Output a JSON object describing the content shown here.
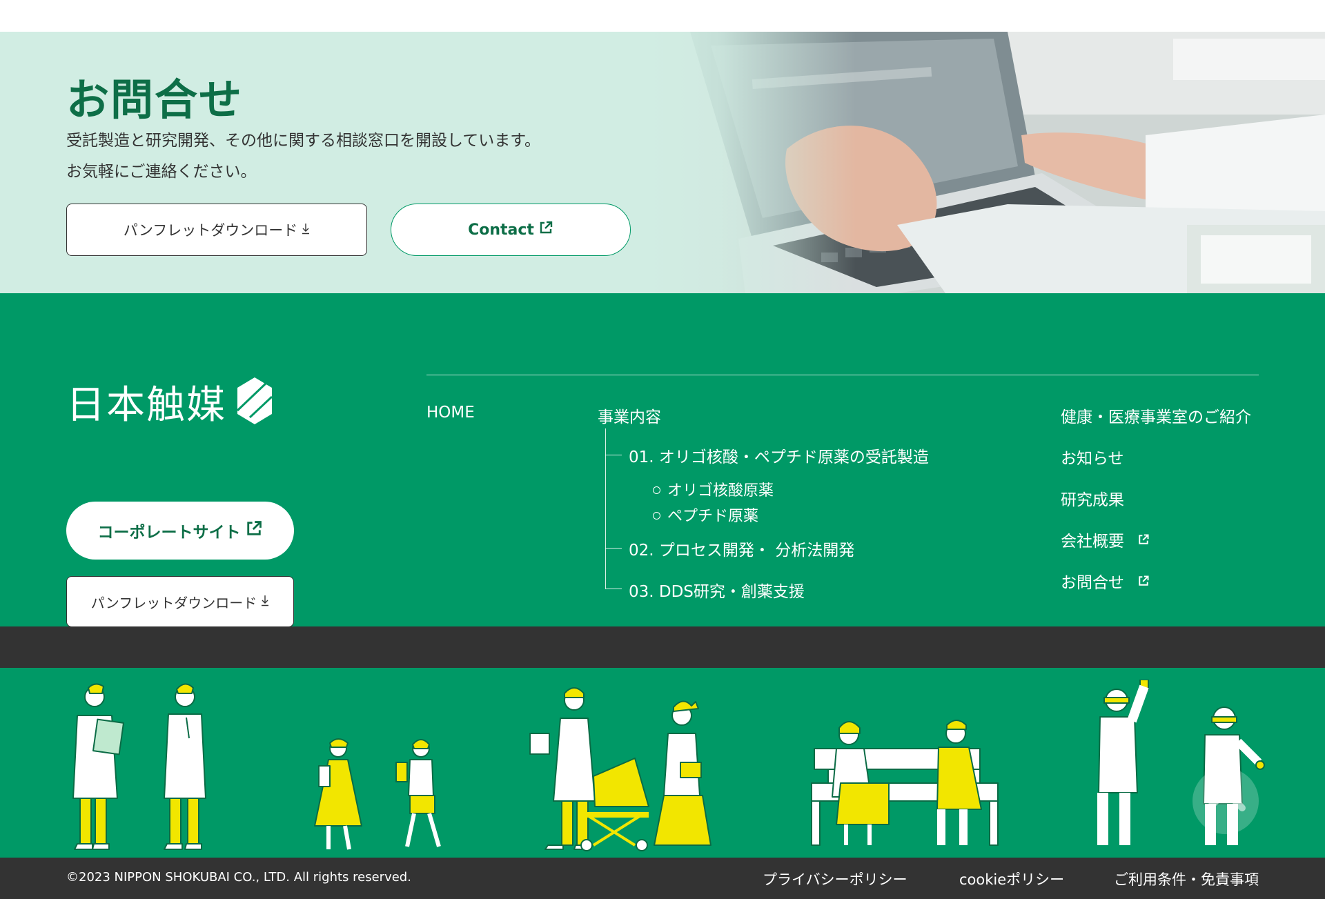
{
  "contact": {
    "title": "お問合せ",
    "text_line1": "受託製造と研究開発、その他に関する相談窓口を開設しています。",
    "text_line2": "お気軽にご連絡ください。",
    "pamphlet_label": "パンフレットダウンロード",
    "contact_label": "Contact"
  },
  "footer": {
    "logo_text": "日本触媒",
    "corporate_label": "コーポレートサイト",
    "pamphlet_label": "パンフレットダウンロード",
    "nav": {
      "home": "HOME",
      "business": "事業内容",
      "business_items": [
        "01. オリゴ核酸・ペプチド原薬の受託製造",
        "オリゴ核酸原薬",
        "ペプチド原薬",
        "02. プロセス開発・ 分析法開発",
        "03. DDS研究・創薬支援"
      ],
      "right_items": [
        "健康・医療事業室のご紹介",
        "お知らせ",
        "研究成果",
        "会社概要",
        "お問合せ"
      ]
    }
  },
  "bottom": {
    "copyright": "©2023 NIPPON SHOKUBAI CO., LTD. All rights reserved.",
    "privacy": "プライバシーポリシー",
    "cookie": "cookieポリシー",
    "terms": "ご利用条件・免責事項"
  },
  "colors": {
    "brand_green": "#009966",
    "dark_green": "#0d6e47",
    "mint": "#d1ede3",
    "accent_yellow": "#f2e600",
    "bar": "#333333"
  },
  "icons": [
    "download-icon",
    "external-link-icon",
    "logo-hexagon-icon",
    "arrow-up-icon"
  ]
}
